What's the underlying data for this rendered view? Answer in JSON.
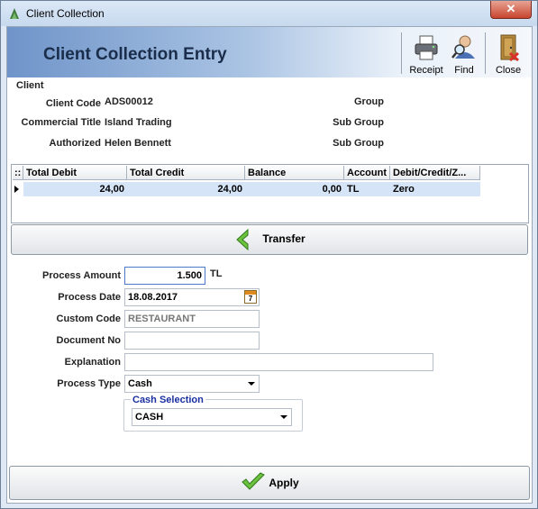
{
  "window": {
    "title": "Client Collection",
    "close_glyph": "✕"
  },
  "header": {
    "title": "Client Collection Entry"
  },
  "toolbar": [
    {
      "label": "Receipt",
      "icon": "printer-icon"
    },
    {
      "label": "Find",
      "icon": "find-user-icon"
    },
    {
      "label": "Close",
      "icon": "exit-door-icon"
    }
  ],
  "client": {
    "section_label": "Client",
    "code_label": "Client Code",
    "code_value": "ADS00012",
    "title_label": "Commercial Title",
    "title_value": "Island Trading",
    "authorized_label": "Authorized",
    "authorized_value": "Helen Bennett",
    "group_label": "Group",
    "sub_group_label_1": "Sub Group",
    "sub_group_label_2": "Sub Group"
  },
  "grid": {
    "columns": [
      "Total Debit",
      "Total Credit",
      "Balance",
      "Account",
      "Debit/Credit/Z..."
    ],
    "row": {
      "total_debit": "24,00",
      "total_credit": "24,00",
      "balance": "0,00",
      "account": "TL",
      "dcz": "Zero"
    }
  },
  "transfer_button": {
    "label": "Transfer"
  },
  "form": {
    "process_amount_label": "Process Amount",
    "process_amount_value": "1.500",
    "currency": "TL",
    "process_date_label": "Process Date",
    "process_date_value": "18.08.2017",
    "calendar_day": "7",
    "custom_code_label": "Custom Code",
    "custom_code_value": "RESTAURANT",
    "document_no_label": "Document No",
    "document_no_value": "",
    "explanation_label": "Explanation",
    "explanation_value": "",
    "process_type_label": "Process Type",
    "process_type_value": "Cash",
    "cash_selection_label": "Cash Selection",
    "cash_selection_value": "CASH"
  },
  "apply_button": {
    "label": "Apply"
  },
  "colors": {
    "accent_blue": "#6f94c9",
    "grid_selected": "#d5e4f7",
    "title_close_red": "#c7452f"
  }
}
